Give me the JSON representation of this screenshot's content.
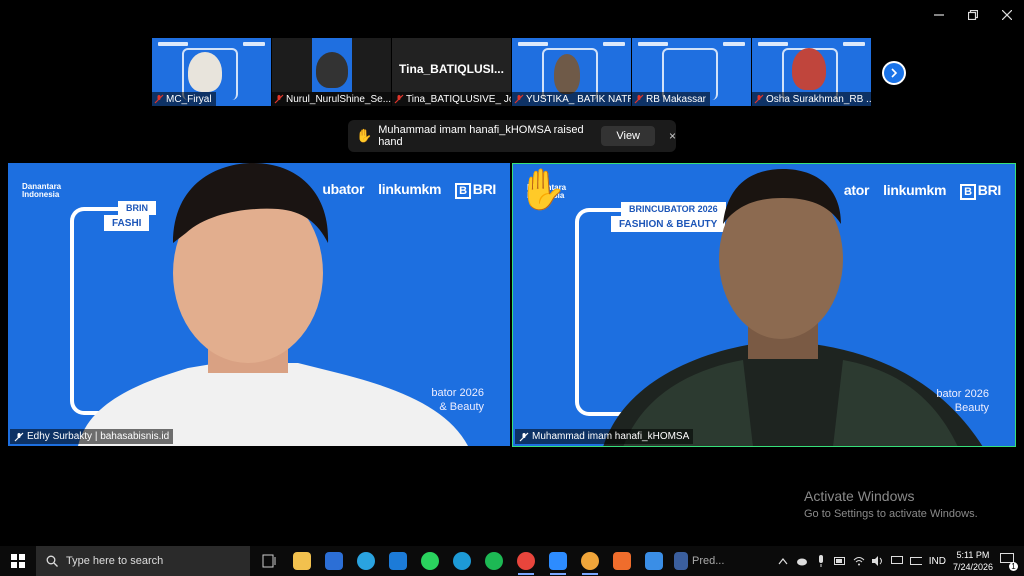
{
  "participants": [
    {
      "name": "MC_Firyal",
      "muted": true
    },
    {
      "name": "Nurul_NurulShine_Se...",
      "muted": true
    },
    {
      "name": "Tina_BATIQLUSIVE_ Jo...",
      "display_name": "Tina_BATIQLUSI...",
      "muted": true
    },
    {
      "name": "YUSTIKA_ BATIK NATR...",
      "muted": true
    },
    {
      "name": "RB Makassar",
      "muted": true
    },
    {
      "name": "Osha Surakhman_RB ...",
      "muted": true
    }
  ],
  "notification": {
    "text": "Muhammad imam hanafi_kHOMSA raised hand",
    "view_label": "View",
    "close_label": "×"
  },
  "speakers": [
    {
      "name": "Edhy Surbakty | bahasabisnis.id"
    },
    {
      "name": "Muhammad imam hanafi_kHOMSA"
    }
  ],
  "background": {
    "danantara": "Danantara Indonesia",
    "brincubator": "BRINCUBATOR 2026",
    "fashion": "FASHION & BEAUTY",
    "brand_ubator": "ubator",
    "brand_ator": "ator",
    "linkumkm": "linkumkm",
    "bri": "BRI",
    "tail_left_1": "bator 2026",
    "tail_left_2": "& Beauty",
    "tail_right_1": "bator 2026",
    "tail_right_2": "Beauty",
    "tag_left_1": "BRIN",
    "tag_left_2": "FASHI"
  },
  "watermark": {
    "title": "Activate Windows",
    "subtitle": "Go to Settings to activate Windows."
  },
  "taskbar": {
    "search_placeholder": "Type here to search",
    "pinned_label": "Pred...",
    "lang": "IND",
    "time": "5:11 PM",
    "date": "7/24/2026",
    "notif_count": "1"
  },
  "colors": {
    "tile_blue": "#1d6fe0",
    "active_border": "#37e07a",
    "mute_red": "#e0352b",
    "raised_hand": "#f5b82e"
  }
}
